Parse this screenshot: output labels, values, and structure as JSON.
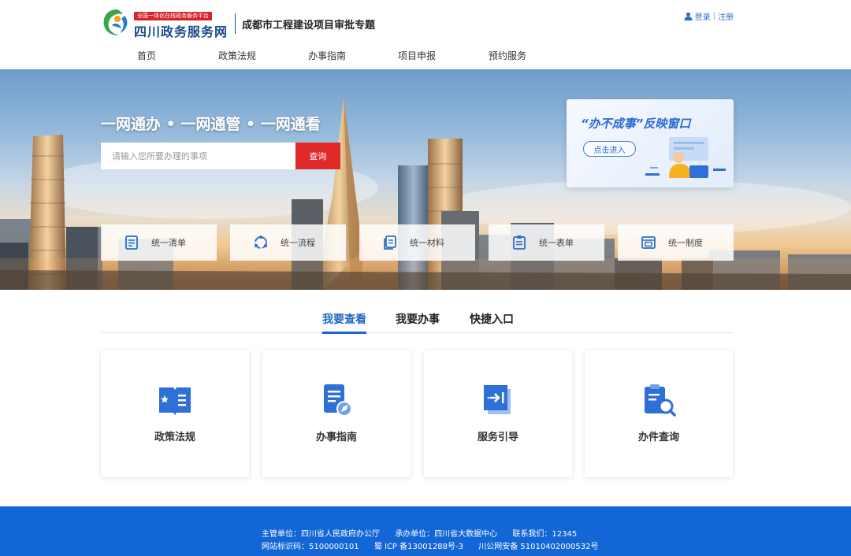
{
  "header": {
    "badge": "全国一体化在线政务服务平台",
    "brand": "四川政务服务网",
    "topic": "成都市工程建设项目审批专题",
    "login": "登录",
    "separator": "|",
    "register": "注册"
  },
  "nav": {
    "items": [
      {
        "label": "首页",
        "active": true
      },
      {
        "label": "政策法规",
        "active": false
      },
      {
        "label": "办事指南",
        "active": false
      },
      {
        "label": "项目申报",
        "active": false
      },
      {
        "label": "预约服务",
        "active": false
      }
    ]
  },
  "hero": {
    "slogan": "一网通办 • 一网通管 • 一网通看",
    "search_placeholder": "请输入您所要办理的事项",
    "search_button": "查询",
    "feedback_title": "“办不成事”反映窗口",
    "feedback_button": "点击进入",
    "unify": [
      {
        "label": "统一清单",
        "icon": "list-icon"
      },
      {
        "label": "统一流程",
        "icon": "process-icon"
      },
      {
        "label": "统一材料",
        "icon": "materials-icon"
      },
      {
        "label": "统一表单",
        "icon": "form-icon"
      },
      {
        "label": "统一制度",
        "icon": "system-icon"
      }
    ]
  },
  "tabs": [
    {
      "label": "我要查看",
      "active": true
    },
    {
      "label": "我要办事",
      "active": false
    },
    {
      "label": "快捷入口",
      "active": false
    }
  ],
  "cards": [
    {
      "label": "政策法规",
      "icon": "policy-book-icon"
    },
    {
      "label": "办事指南",
      "icon": "guide-document-icon"
    },
    {
      "label": "服务引导",
      "icon": "service-guide-icon"
    },
    {
      "label": "办件查询",
      "icon": "case-search-icon"
    }
  ],
  "footer": {
    "line1": [
      "主管单位：四川省人民政府办公厅",
      "承办单位：四川省大数据中心",
      "联系我们：12345"
    ],
    "line2": [
      "网站标识码：5100000101",
      "蜀 ICP 备13001288号-3",
      "川公网安备 51010402000532号"
    ]
  },
  "colors": {
    "primary": "#1c66c9",
    "search_button": "#e02a2a",
    "footer": "#1266d6",
    "badge": "#d6252c"
  }
}
